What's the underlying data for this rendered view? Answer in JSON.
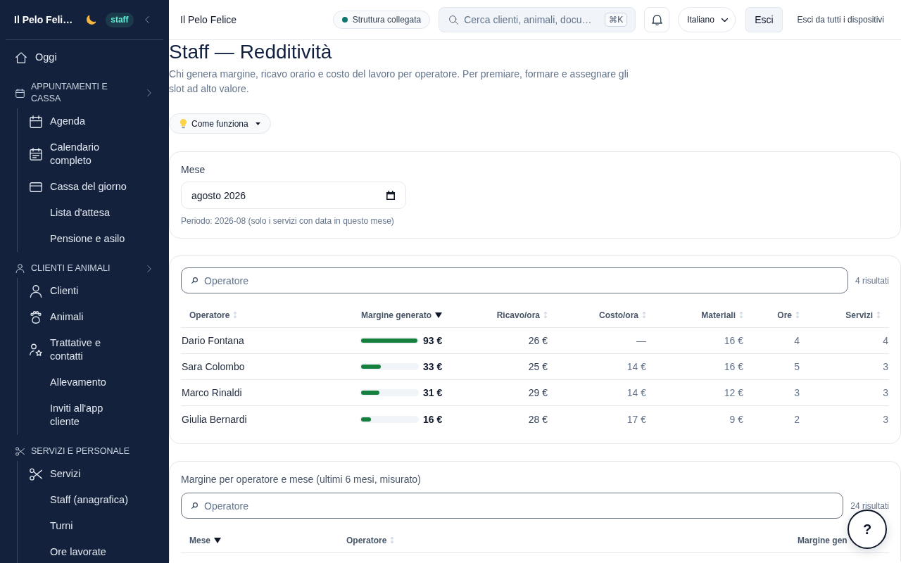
{
  "sidebar": {
    "brand": "Il Pelo Feli…",
    "badge": "staff",
    "nav": [
      {
        "kind": "link",
        "label": "Oggi",
        "selected": false
      },
      {
        "kind": "group",
        "label": "APPUNTAMENTI E CASSA",
        "collapsible": true,
        "children": [
          {
            "label": "Agenda",
            "selected": false
          },
          {
            "label": "Calendario completo",
            "selected": false
          },
          {
            "label": "Cassa del giorno",
            "selected": false
          },
          {
            "label": "Lista d'attesa",
            "selected": false
          },
          {
            "label": "Pensione e asilo",
            "selected": false
          }
        ]
      },
      {
        "kind": "group",
        "label": "CLIENTI E ANIMALI",
        "collapsible": true,
        "children": [
          {
            "label": "Clienti",
            "selected": false
          },
          {
            "label": "Animali",
            "selected": false
          },
          {
            "label": "Trattative e contatti",
            "selected": false
          },
          {
            "label": "Allevamento",
            "selected": false
          },
          {
            "label": "Inviti all'app cliente",
            "selected": false
          }
        ]
      },
      {
        "kind": "group",
        "label": "SERVIZI E PERSONALE",
        "collapsible": false,
        "children": [
          {
            "label": "Servizi",
            "selected": false
          },
          {
            "label": "Staff (anagrafica)",
            "selected": false
          },
          {
            "label": "Turni",
            "selected": false
          },
          {
            "label": "Ore lavorate",
            "selected": false
          }
        ]
      }
    ]
  },
  "topbar": {
    "title": "Il Pelo Felice",
    "status": "Struttura collegata",
    "search": {
      "placeholder": "Cerca clienti, animali, docu…",
      "shortcut": "⌘K"
    },
    "language": "Italiano",
    "logout": "Esci",
    "logout_all": "Esci da tutti i dispositivi"
  },
  "page": {
    "title": "Staff — Redditività",
    "description": "Chi genera margine, ricavo orario e costo del lavoro per operatore. Per premiare, formare e assegnare gli slot ad alto valore.",
    "help_toggle": {
      "label": "Come funziona",
      "expanded": false
    }
  },
  "period": {
    "label": "Mese",
    "value": "agosto 2026",
    "hint": "Periodo: 2026-08 (solo i servizi con data in questo mese)"
  },
  "profitability_table": {
    "filter": {
      "placeholder": "Operatore"
    },
    "result_count": "4 risultati",
    "columns": [
      {
        "label": "Operatore",
        "sorted": false
      },
      {
        "label": "Margine generato",
        "sorted": true
      },
      {
        "label": "Ricavo/ora",
        "sorted": false
      },
      {
        "label": "Costo/ora",
        "sorted": false
      },
      {
        "label": "Materiali",
        "sorted": false
      },
      {
        "label": "Ore",
        "sorted": false
      },
      {
        "label": "Servizi",
        "sorted": false
      }
    ],
    "rows": [
      {
        "operator": "Dario Fontana",
        "margin": "93 €",
        "level": 1,
        "revenue_per_hour": "26 €",
        "cost_per_hour": "—",
        "materials": "16 €",
        "hours": "4",
        "services": "4"
      },
      {
        "operator": "Sara Colombo",
        "margin": "33 €",
        "level": 0.35,
        "revenue_per_hour": "25 €",
        "cost_per_hour": "14 €",
        "materials": "16 €",
        "hours": "5",
        "services": "3"
      },
      {
        "operator": "Marco Rinaldi",
        "margin": "31 €",
        "level": 0.33,
        "revenue_per_hour": "29 €",
        "cost_per_hour": "14 €",
        "materials": "12 €",
        "hours": "3",
        "services": "3"
      },
      {
        "operator": "Giulia Bernardi",
        "margin": "16 €",
        "level": 0.17,
        "revenue_per_hour": "28 €",
        "cost_per_hour": "17 €",
        "materials": "9 €",
        "hours": "2",
        "services": "3"
      }
    ]
  },
  "monthly_table": {
    "title": "Margine per operatore e mese (ultimi 6 mesi, misurato)",
    "filter": {
      "placeholder": "Operatore"
    },
    "result_count": "24 risultati",
    "columns": [
      {
        "label": "Mese",
        "sorted": true
      },
      {
        "label": "Operatore",
        "sorted": false
      },
      {
        "label": "Margine gen"
      }
    ]
  },
  "help_button": {
    "label": "?"
  }
}
